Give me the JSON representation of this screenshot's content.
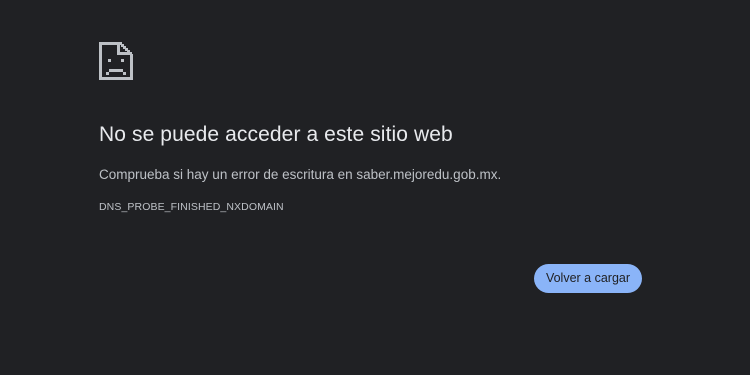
{
  "error_page": {
    "icon": "sad-page-icon",
    "title": "No se puede acceder a este sitio web",
    "message": "Comprueba si hay un error de escritura en saber.mejoredu.gob.mx.",
    "error_code": "DNS_PROBE_FINISHED_NXDOMAIN",
    "reload_label": "Volver a cargar"
  },
  "colors": {
    "background": "#202124",
    "title": "#e8eaed",
    "text": "#bdc1c6",
    "button": "#8ab4f8",
    "button_text": "#202124"
  }
}
